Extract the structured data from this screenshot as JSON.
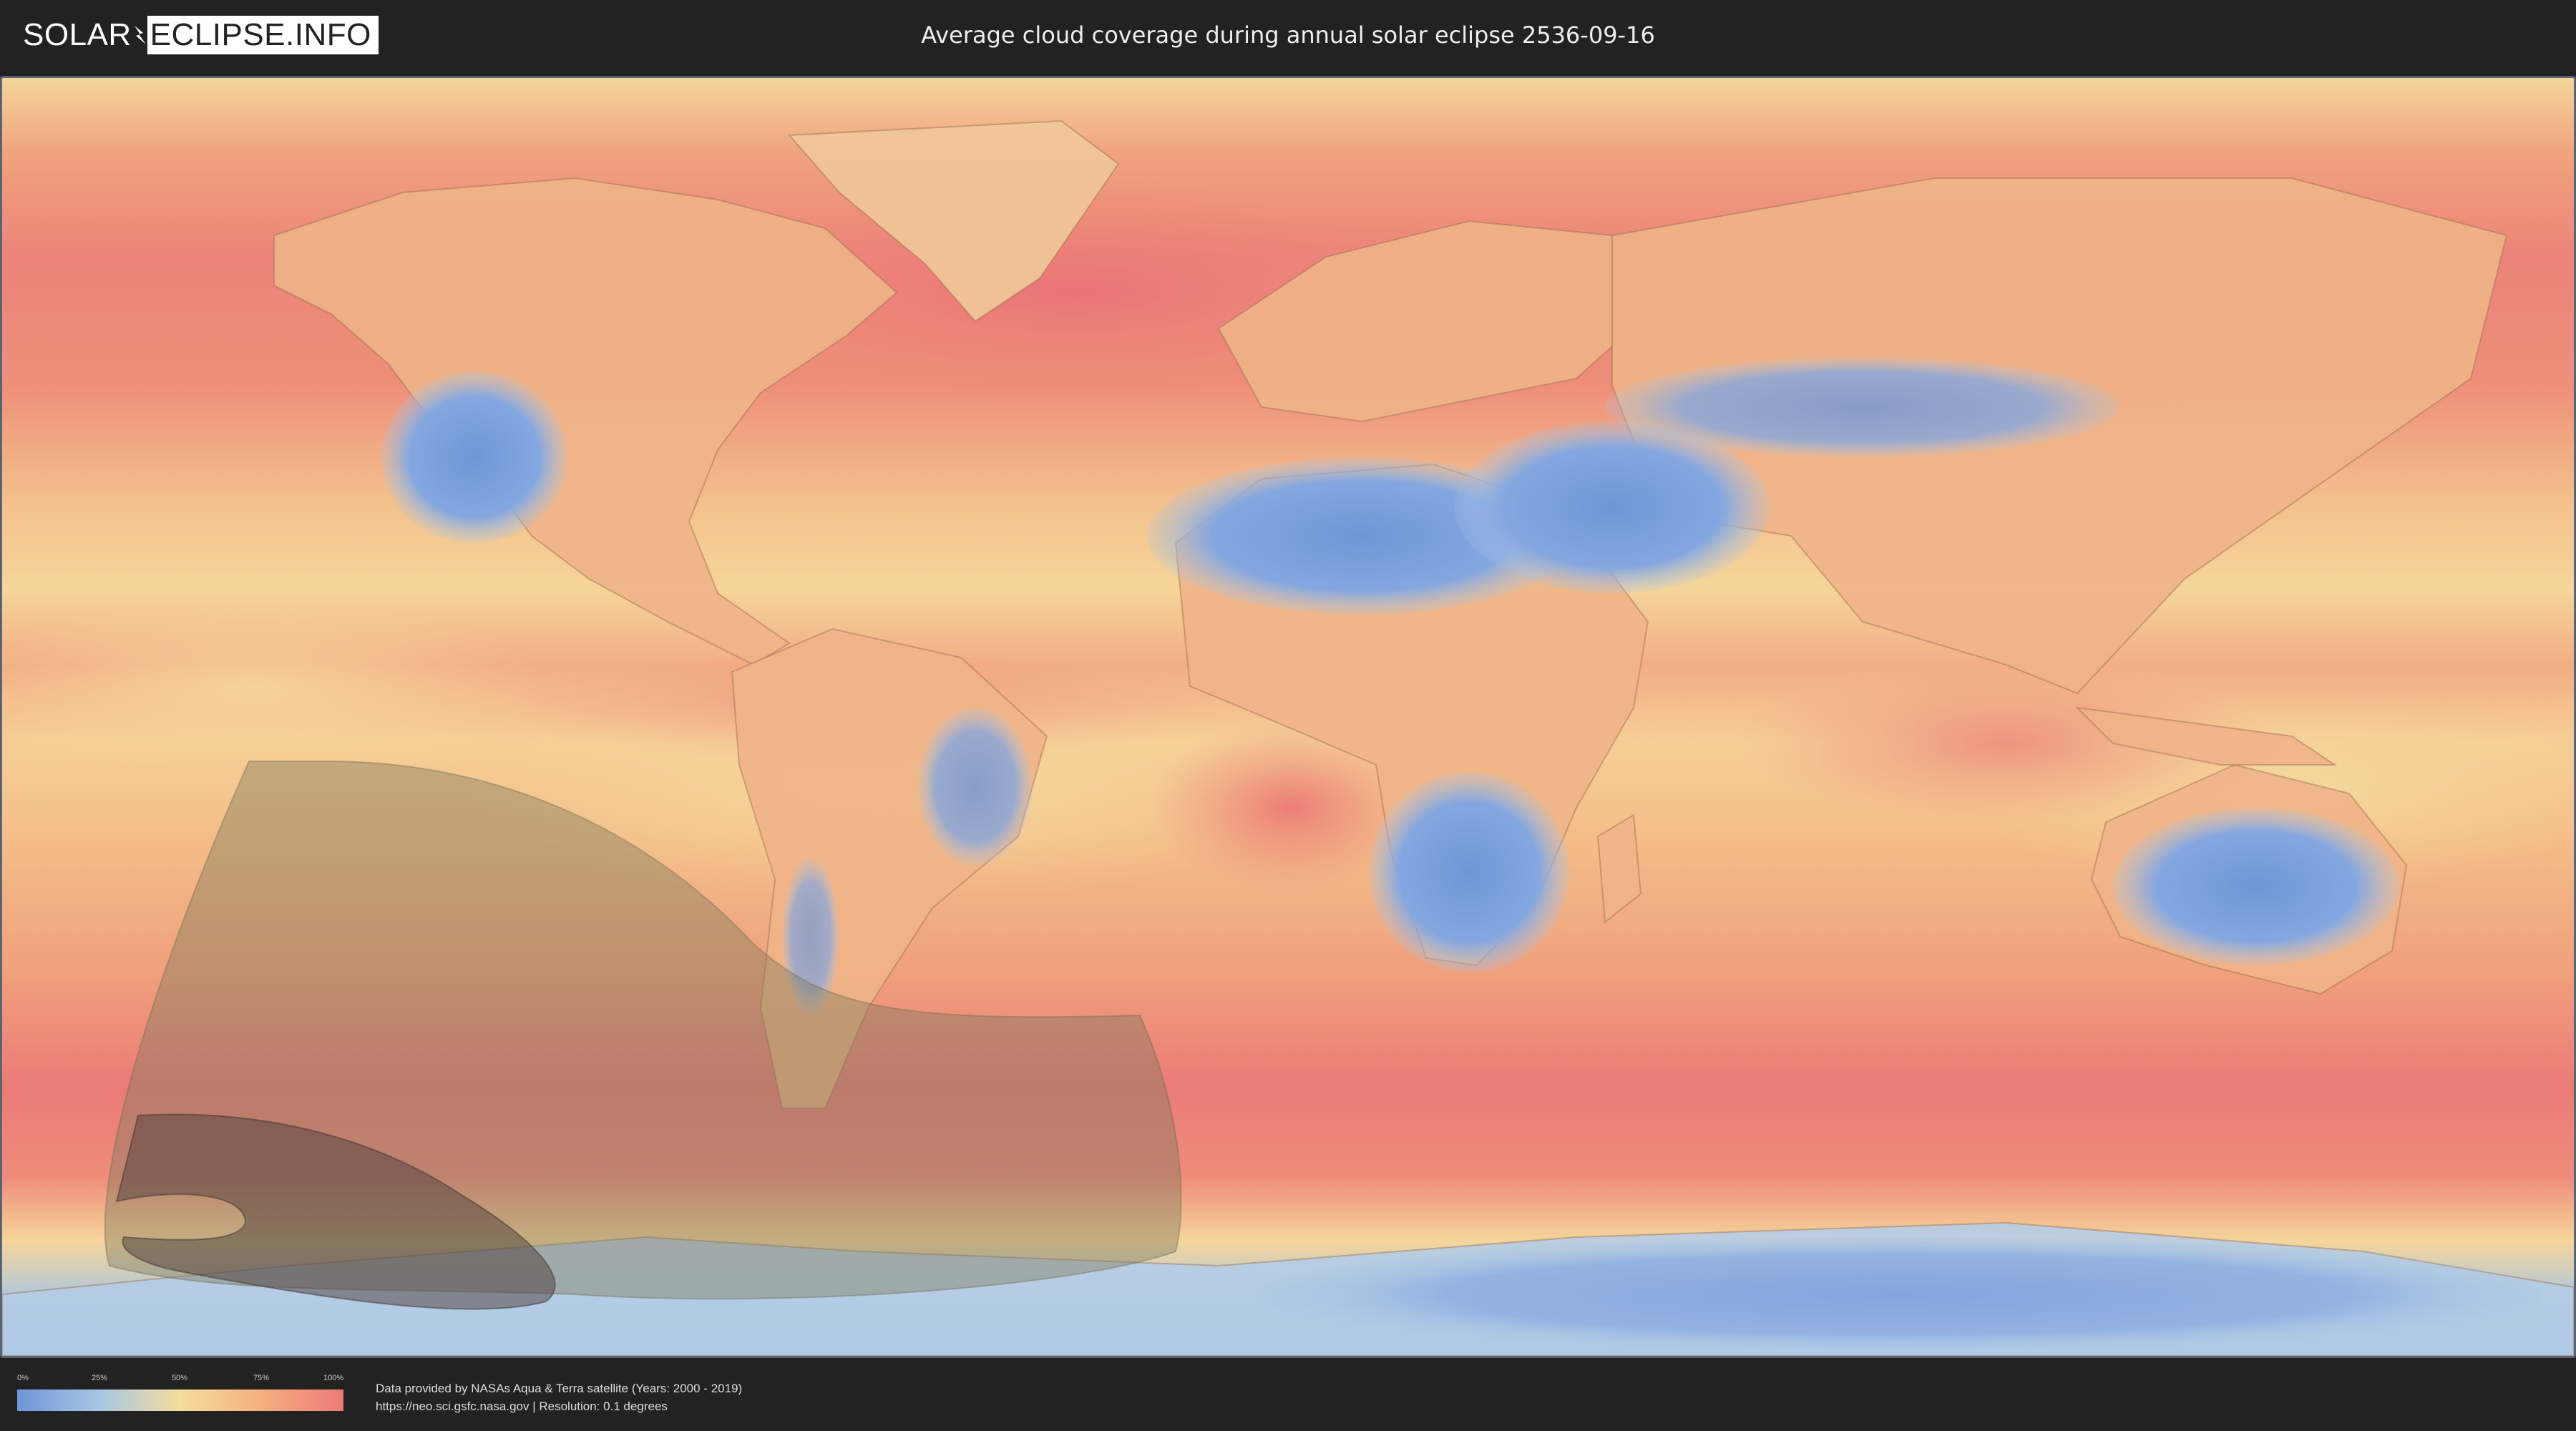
{
  "header": {
    "logo_part1": "SOLAR",
    "logo_part2": "ECLIPSE.INFO",
    "title": "Average cloud coverage during annual solar eclipse 2536-09-16"
  },
  "legend": {
    "ticks": [
      "0%",
      "25%",
      "50%",
      "75%",
      "100%"
    ],
    "colors": [
      "#6f96d8",
      "#a6c6e4",
      "#f5dd9c",
      "#f4b07f",
      "#ee7a78"
    ]
  },
  "credits": {
    "line1": "Data provided by NASAs Aqua & Terra satellite (Years: 2000 - 2019)",
    "line2": "https://neo.sci.gsfc.nasa.gov | Resolution: 0.1 degrees"
  },
  "map": {
    "projection": "equirectangular",
    "overlay_colors": {
      "partial_zone": "#8a8a6a",
      "annular_path": "#5a4a4a"
    }
  }
}
